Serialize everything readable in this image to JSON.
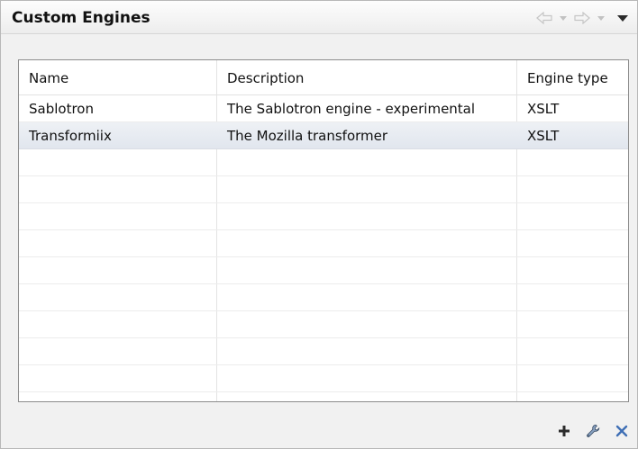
{
  "panel": {
    "title": "Custom Engines"
  },
  "nav": {
    "back_icon": "arrow-left-outline-icon",
    "forward_icon": "arrow-right-outline-icon",
    "menu_icon": "view-menu-icon"
  },
  "table": {
    "columns": [
      "Name",
      "Description",
      "Engine type"
    ],
    "rows": [
      {
        "name": "Sablotron",
        "description": "The Sablotron engine - experimental",
        "type": "XSLT",
        "selected": false
      },
      {
        "name": "Transformiix",
        "description": "The Mozilla transformer",
        "type": "XSLT",
        "selected": true
      }
    ]
  },
  "footer": {
    "add_icon": "plus-icon",
    "edit_icon": "wrench-icon",
    "remove_icon": "close-icon"
  },
  "colors": {
    "selection": "#e4e8ef",
    "remove": "#3f6fb5"
  }
}
